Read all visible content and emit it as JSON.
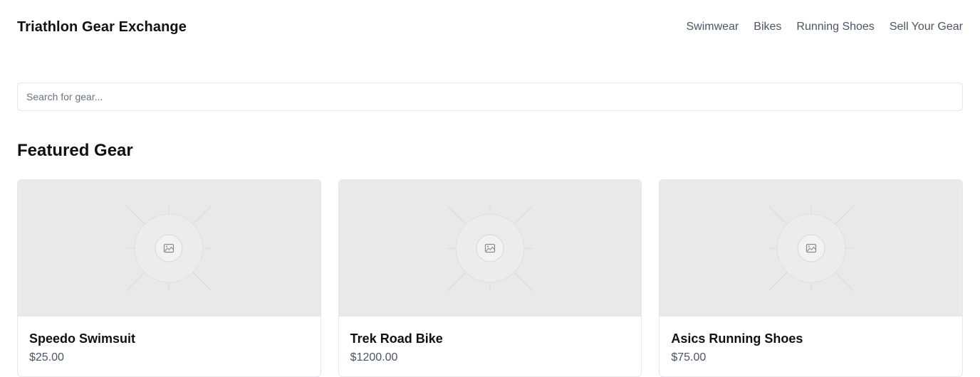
{
  "header": {
    "brand": "Triathlon Gear Exchange",
    "nav": [
      {
        "label": "Swimwear"
      },
      {
        "label": "Bikes"
      },
      {
        "label": "Running Shoes"
      },
      {
        "label": "Sell Your Gear"
      }
    ]
  },
  "search": {
    "placeholder": "Search for gear...",
    "value": ""
  },
  "featured": {
    "title": "Featured Gear",
    "items": [
      {
        "name": "Speedo Swimsuit",
        "price": "$25.00",
        "image_icon": "image-placeholder-icon"
      },
      {
        "name": "Trek Road Bike",
        "price": "$1200.00",
        "image_icon": "image-placeholder-icon"
      },
      {
        "name": "Asics Running Shoes",
        "price": "$75.00",
        "image_icon": "image-placeholder-icon"
      }
    ]
  },
  "colors": {
    "text_primary": "#111111",
    "text_secondary": "#4b5563",
    "border": "#e5e7eb",
    "image_placeholder_bg": "#e9e9e9"
  }
}
